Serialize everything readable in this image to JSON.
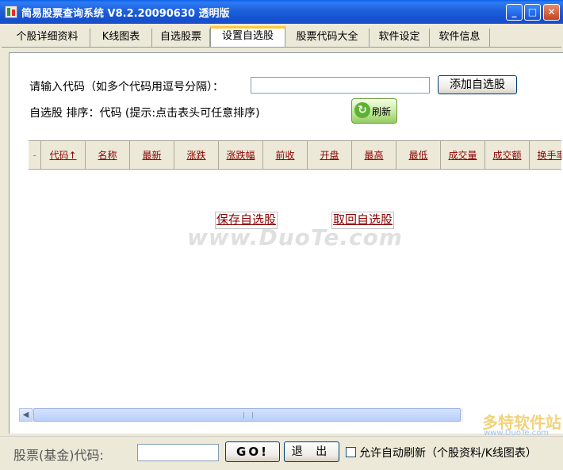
{
  "window": {
    "title": "简易股票查询系统 V8.2.20090630 透明版",
    "minimize": "_",
    "maximize": "□",
    "close": "✕"
  },
  "tabs": [
    {
      "label": "个股详细资料",
      "active": false
    },
    {
      "label": "K线图表",
      "active": false
    },
    {
      "label": "自选股票",
      "active": false
    },
    {
      "label": "设置自选股",
      "active": true
    },
    {
      "label": "股票代码大全",
      "active": false
    },
    {
      "label": "软件设定",
      "active": false
    },
    {
      "label": "软件信息",
      "active": false
    }
  ],
  "form": {
    "code_label": "请输入代码（如多个代码用逗号分隔）：",
    "code_value": "",
    "add_button": "添加自选股",
    "status_text": "自选股  排序：代码  (提示:点击表头可任意排序)",
    "refresh_button": "刷新",
    "refresh_icon": "refresh-icon"
  },
  "grid": {
    "corner": "-",
    "columns": [
      "代码↑",
      "名称",
      "最新",
      "涨跌",
      "涨跌幅",
      "前收",
      "开盘",
      "最高",
      "最低",
      "成交量",
      "成交额",
      "换手率"
    ],
    "rows": []
  },
  "links": {
    "save": "保存自选股",
    "load": "取回自选股"
  },
  "watermarks": {
    "main": "www.DuoTe.com",
    "logo_text": "多特软件站",
    "logo_url": "www.DuoTe.com"
  },
  "bottom": {
    "code_label": "股票(基金)代码:",
    "code_value": "",
    "go_button": "GO!",
    "exit_button": "退 出",
    "auto_refresh_checked": false,
    "auto_refresh_label": "允许自动刷新（个股资料/K线图表）"
  }
}
